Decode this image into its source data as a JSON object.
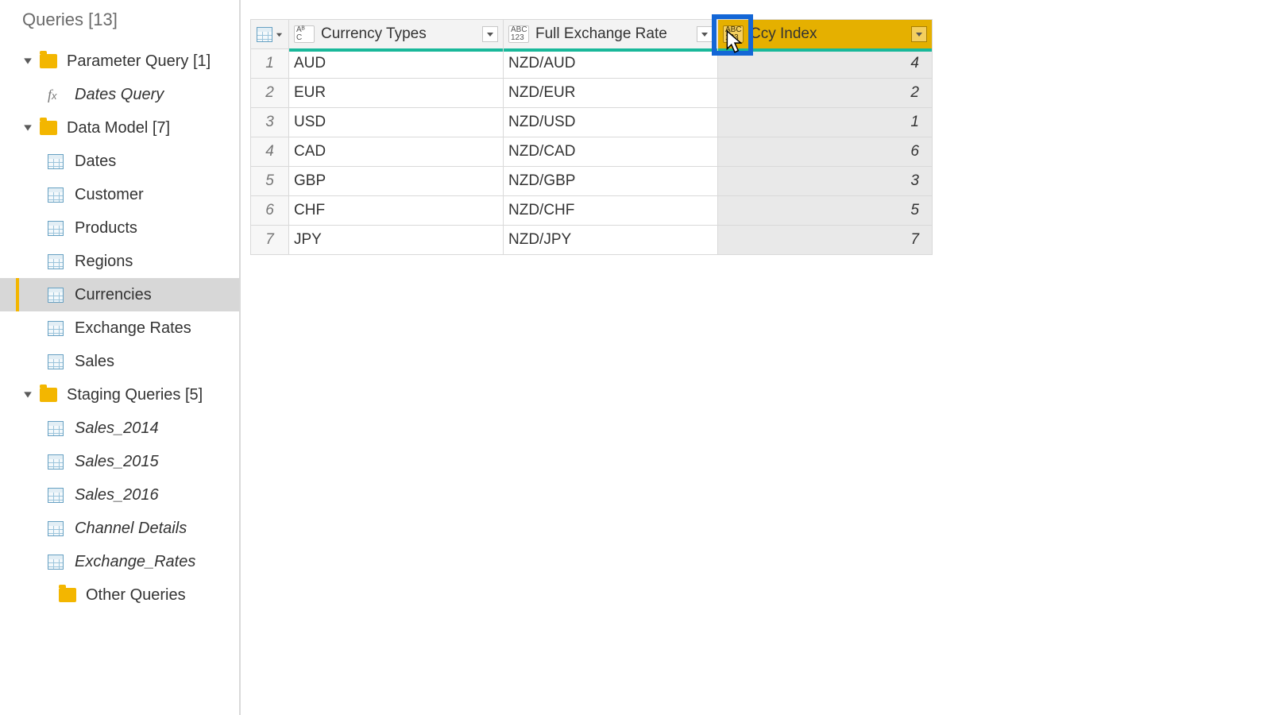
{
  "sidebar": {
    "title": "Queries [13]",
    "groups": [
      {
        "label": "Parameter Query [1]",
        "items": [
          {
            "label": "Dates Query",
            "icon": "fx",
            "italic": true
          }
        ]
      },
      {
        "label": "Data Model [7]",
        "items": [
          {
            "label": "Dates",
            "icon": "table"
          },
          {
            "label": "Customer",
            "icon": "table"
          },
          {
            "label": "Products",
            "icon": "table"
          },
          {
            "label": "Regions",
            "icon": "table"
          },
          {
            "label": "Currencies",
            "icon": "table",
            "selected": true
          },
          {
            "label": "Exchange Rates",
            "icon": "table"
          },
          {
            "label": "Sales",
            "icon": "table"
          }
        ]
      },
      {
        "label": "Staging Queries [5]",
        "items": [
          {
            "label": "Sales_2014",
            "icon": "table",
            "italic": true
          },
          {
            "label": "Sales_2015",
            "icon": "table",
            "italic": true
          },
          {
            "label": "Sales_2016",
            "icon": "table",
            "italic": true
          },
          {
            "label": "Channel Details",
            "icon": "table",
            "italic": true
          },
          {
            "label": "Exchange_Rates",
            "icon": "table",
            "italic": true
          }
        ]
      },
      {
        "label": "Other Queries",
        "leaf_folder": true
      }
    ]
  },
  "table": {
    "columns": [
      {
        "name": "Currency Types",
        "dtype_top": "Aᴮ",
        "dtype_bot": " C",
        "selected": false
      },
      {
        "name": "Full Exchange Rate",
        "dtype_top": "ABC",
        "dtype_bot": "123",
        "selected": false
      },
      {
        "name": "Ccy Index",
        "dtype_top": "ABC",
        "dtype_bot": "123",
        "selected": true
      }
    ],
    "rows": [
      {
        "n": "1",
        "ct": "AUD",
        "fx": "NZD/AUD",
        "ci": "4"
      },
      {
        "n": "2",
        "ct": "EUR",
        "fx": "NZD/EUR",
        "ci": "2"
      },
      {
        "n": "3",
        "ct": "USD",
        "fx": "NZD/USD",
        "ci": "1"
      },
      {
        "n": "4",
        "ct": "CAD",
        "fx": "NZD/CAD",
        "ci": "6"
      },
      {
        "n": "5",
        "ct": "GBP",
        "fx": "NZD/GBP",
        "ci": "3"
      },
      {
        "n": "6",
        "ct": "CHF",
        "fx": "NZD/CHF",
        "ci": "5"
      },
      {
        "n": "7",
        "ct": "JPY",
        "fx": "NZD/JPY",
        "ci": "7"
      }
    ]
  }
}
